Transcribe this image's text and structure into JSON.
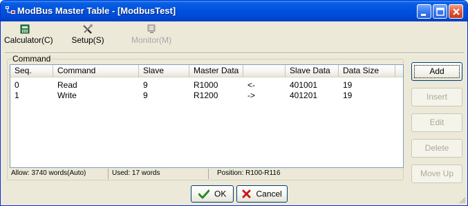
{
  "window": {
    "title": "ModBus Master Table - [ModbusTest]"
  },
  "toolbar": {
    "calculator_label": "Calculator(C)",
    "setup_label": "Setup(S)",
    "monitor_label": "Monitor(M)"
  },
  "group": {
    "label": "Command"
  },
  "table": {
    "headers": [
      "Seq.",
      "Command",
      "Slave",
      "Master Data",
      "",
      "Slave Data",
      "Data Size",
      ""
    ],
    "rows": [
      {
        "seq": "0",
        "command": "Read",
        "slave": "9",
        "master": "R1000",
        "dir": "<-",
        "slave_data": "401001",
        "size": "19"
      },
      {
        "seq": "1",
        "command": "Write",
        "slave": "9",
        "master": "R1200",
        "dir": "->",
        "slave_data": "401201",
        "size": "19"
      }
    ]
  },
  "status": {
    "allow": "Allow: 3740 words(Auto)",
    "used": "Used: 17 words",
    "position": "Position: R100-R116"
  },
  "buttons": {
    "add": "Add",
    "insert": "Insert",
    "edit": "Edit",
    "delete": "Delete",
    "move_up": "Move Up",
    "ok": "OK",
    "cancel": "Cancel"
  },
  "colors": {
    "title_bar": "#0052e0",
    "window_bg": "#ece9d8",
    "ok_check": "#2a8a1f",
    "cancel_x": "#c81818"
  }
}
